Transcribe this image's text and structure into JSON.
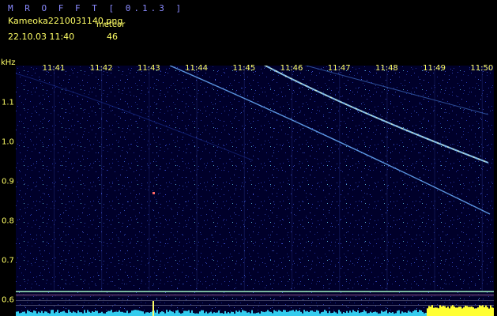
{
  "header": {
    "app_title": "M R O F F T  [ 0.1.3 ]",
    "file_name": "Kameoka2210031140.png",
    "meteor_label": "meteor",
    "date_time": "22.10.03  11:40",
    "meteor_count": "46"
  },
  "axes": {
    "freq_unit": "kHz",
    "time_ticks": [
      "11:41",
      "11:42",
      "11:43",
      "11:44",
      "11:45",
      "11:46",
      "11:47",
      "11:48",
      "11:49",
      "11:50"
    ],
    "freq_ticks": [
      "1.1",
      "1.0",
      "0.9",
      "0.8",
      "0.7",
      "0.6"
    ]
  },
  "colors": {
    "label": "#ffff66",
    "title": "#8a8aff",
    "background": "#000008",
    "trace": "#bfe6ff",
    "cyan_band": "#33ccee"
  }
}
